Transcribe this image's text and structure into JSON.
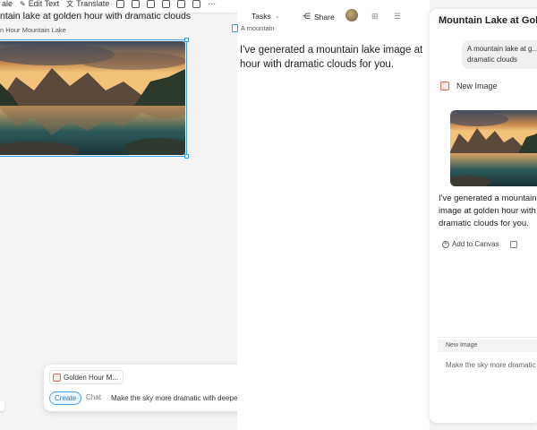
{
  "toolbar": {
    "scale_label": "ale",
    "edit_text_label": "Edit Text",
    "translate_label": "Translate",
    "more_label": "···"
  },
  "canvas": {
    "prompt_title": "ntain lake at golden hour with dramatic clouds",
    "frame_label": "n Hour Mountain Lake"
  },
  "composer": {
    "reference_chip": "Golden Hour M...",
    "mode_create": "Create",
    "mode_chat": "Chat",
    "input_value": "Make the sky more dramatic with deeper colors ..."
  },
  "document": {
    "tasks_label": "Tasks",
    "share_label": "Share",
    "tag_label": "A mountain",
    "body_text": "I've generated a mountain lake image at hour with dramatic clouds for you."
  },
  "chat": {
    "title": "Mountain Lake at Gol...",
    "user_message": "A mountain lake at g... dramatic clouds",
    "new_image_label": "New Image",
    "reply_text": "I've generated a mountain image at golden hour with dramatic clouds for you.",
    "add_to_canvas_label": "Add to Canvas",
    "input_tag": "New Image",
    "input_text": "Make the sky more dramatic"
  },
  "colors": {
    "accent": "#2d8ae8",
    "selection": "#3aa0e8",
    "image_icon": "#e46a52"
  }
}
